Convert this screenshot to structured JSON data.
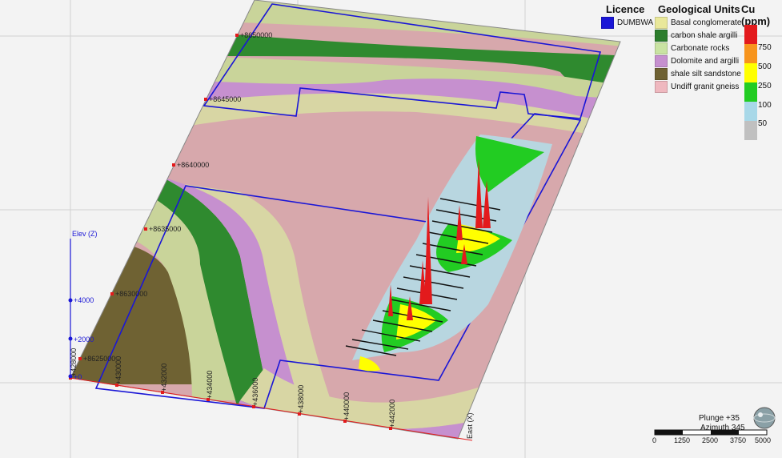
{
  "legend": {
    "licence_title": "Licence",
    "licence_items": [
      {
        "label": "DUMBWA",
        "color": "#1a16d6"
      }
    ],
    "units_title": "Geological Units",
    "units": [
      {
        "label": "Basal conglomerate",
        "color": "#e9e89a"
      },
      {
        "label": "carbon shale argilli",
        "color": "#2c7d2c"
      },
      {
        "label": "Carbonate rocks",
        "color": "#c9e3a2"
      },
      {
        "label": "Dolomite and argilli",
        "color": "#c690cf"
      },
      {
        "label": "shale silt sandstone",
        "color": "#6f6233"
      },
      {
        "label": "Undiff granit gneiss",
        "color": "#efb8bf"
      }
    ],
    "cu_title": "Cu (ppm)",
    "cu_bins": [
      {
        "label": "750",
        "color": "#e31a1c"
      },
      {
        "label": "500",
        "color": "#f7941d"
      },
      {
        "label": "250",
        "color": "#ffff00"
      },
      {
        "label": "100",
        "color": "#22cc22"
      },
      {
        "label": "50",
        "color": "#a8d8e8"
      },
      {
        "label": "",
        "color": "#c0c0c0"
      }
    ]
  },
  "axes": {
    "north_ticks": [
      "+8650000",
      "+8645000",
      "+8640000",
      "+8635000",
      "+8630000",
      "+8625000"
    ],
    "east_ticks": [
      "+428000",
      "+430000",
      "+432000",
      "+434000",
      "+436000",
      "+438000",
      "+440000",
      "+442000"
    ],
    "east_label": "East (X)",
    "elev_label": "Elev (Z)",
    "elev_ticks": [
      "+4000",
      "+2000",
      "+0"
    ]
  },
  "view": {
    "plunge": "Plunge +35",
    "azimuth": "Azimuth 345"
  },
  "scale": {
    "ticks": [
      "0",
      "1250",
      "2500",
      "3750",
      "5000"
    ]
  }
}
